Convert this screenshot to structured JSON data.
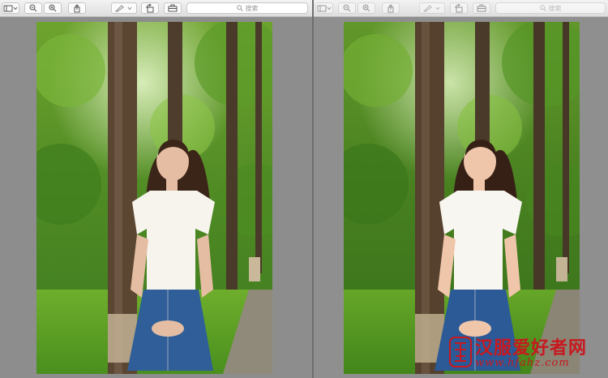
{
  "left_window": {
    "search_placeholder": "搜索"
  },
  "right_window": {
    "search_placeholder": "搜索"
  },
  "watermark": {
    "title": "汉服爱好者网",
    "url": "www.hfahz.com"
  },
  "colors": {
    "toolbar_bg": "#e6e6e6",
    "window_bg": "#8d8d8d",
    "watermark_red": "#c8181f"
  },
  "icons": [
    "sidebar-icon",
    "zoom-out-icon",
    "zoom-in-icon",
    "share-icon",
    "markup-pen-icon",
    "rotate-icon",
    "toolbox-icon",
    "search-icon"
  ]
}
